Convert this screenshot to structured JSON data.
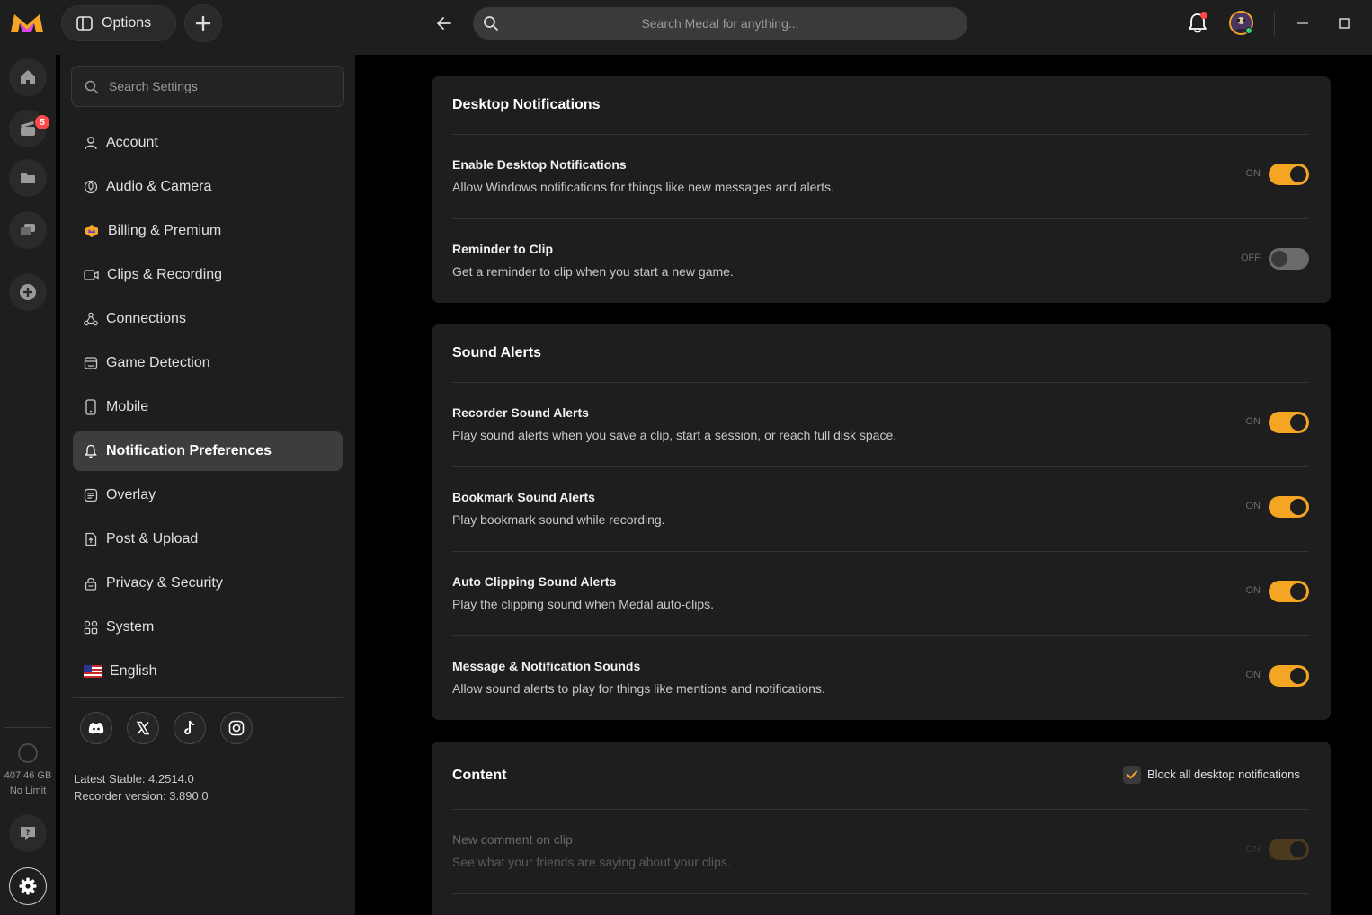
{
  "topbar": {
    "options_label": "Options",
    "search_placeholder": "Search Medal for anything..."
  },
  "rail": {
    "clips_badge": "5",
    "storage_used": "407.46 GB",
    "storage_limit": "No Limit"
  },
  "settings": {
    "search_placeholder": "Search Settings",
    "nav": [
      {
        "label": "Account",
        "icon": "user-icon"
      },
      {
        "label": "Audio & Camera",
        "icon": "microphone-icon"
      },
      {
        "label": "Billing & Premium",
        "icon": "premium-badge-icon"
      },
      {
        "label": "Clips & Recording",
        "icon": "video-camera-icon"
      },
      {
        "label": "Connections",
        "icon": "connections-icon"
      },
      {
        "label": "Game Detection",
        "icon": "game-controller-icon"
      },
      {
        "label": "Mobile",
        "icon": "mobile-phone-icon"
      },
      {
        "label": "Notification Preferences",
        "icon": "bell-icon",
        "active": true
      },
      {
        "label": "Overlay",
        "icon": "overlay-icon"
      },
      {
        "label": "Post & Upload",
        "icon": "upload-icon"
      },
      {
        "label": "Privacy & Security",
        "icon": "lock-icon"
      },
      {
        "label": "System",
        "icon": "grid-icon"
      },
      {
        "label": "English",
        "icon": "us-flag-icon"
      }
    ],
    "social": [
      "discord-icon",
      "x-icon",
      "tiktok-icon",
      "instagram-icon"
    ],
    "latest_stable": "Latest Stable: 4.2514.0",
    "recorder_version": "Recorder version: 3.890.0"
  },
  "sections": {
    "desktop": {
      "title": "Desktop Notifications",
      "rows": [
        {
          "title": "Enable Desktop Notifications",
          "desc": "Allow Windows notifications for things like new messages and alerts.",
          "state": "ON"
        },
        {
          "title": "Reminder to Clip",
          "desc": "Get a reminder to clip when you start a new game.",
          "state": "OFF"
        }
      ]
    },
    "sound": {
      "title": "Sound Alerts",
      "rows": [
        {
          "title": "Recorder Sound Alerts",
          "desc": "Play sound alerts when you save a clip, start a session, or reach full disk space.",
          "state": "ON"
        },
        {
          "title": "Bookmark Sound Alerts",
          "desc": "Play bookmark sound while recording.",
          "state": "ON"
        },
        {
          "title": "Auto Clipping Sound Alerts",
          "desc": "Play the clipping sound when Medal auto-clips.",
          "state": "ON"
        },
        {
          "title": "Message & Notification Sounds",
          "desc": "Allow sound alerts to play for things like mentions and notifications.",
          "state": "ON"
        }
      ]
    },
    "content": {
      "title": "Content",
      "block_all_label": "Block all desktop notifications",
      "block_all_checked": true,
      "rows": [
        {
          "title": "New comment on clip",
          "desc": "See what your friends are saying about your clips.",
          "state": "ON"
        }
      ]
    }
  },
  "colors": {
    "accent": "#f5a524",
    "background": "#000000",
    "panel": "#1e1e1e"
  }
}
